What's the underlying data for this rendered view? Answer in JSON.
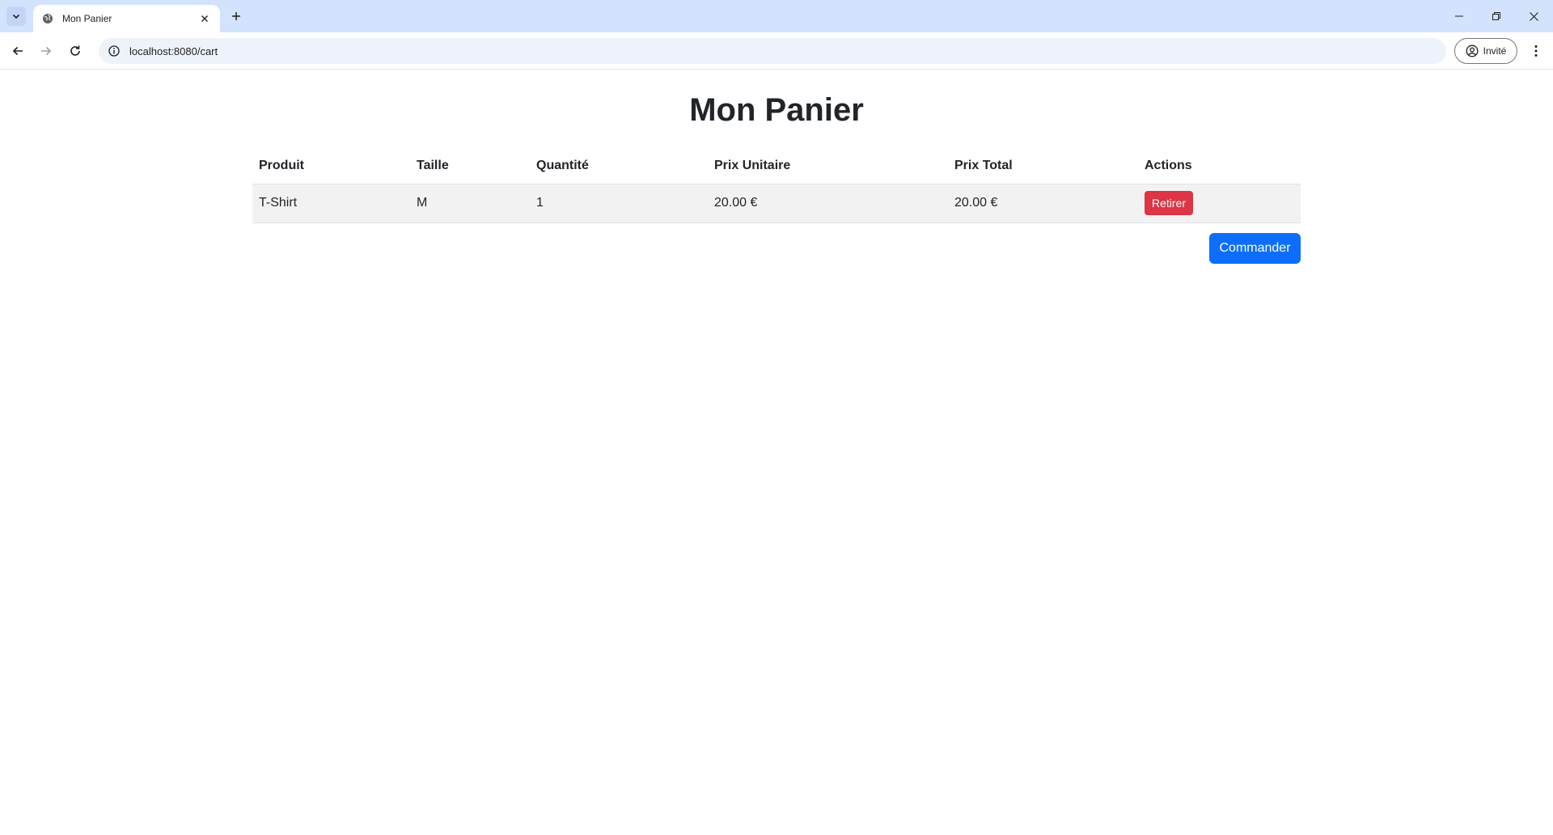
{
  "browser": {
    "tab_title": "Mon Panier",
    "url": "localhost:8080/cart",
    "profile_label": "Invité"
  },
  "page": {
    "title": "Mon Panier",
    "table": {
      "headers": [
        "Produit",
        "Taille",
        "Quantité",
        "Prix Unitaire",
        "Prix Total",
        "Actions"
      ],
      "rows": [
        {
          "product": "T-Shirt",
          "size": "M",
          "quantity": "1",
          "unit_price": "20.00 €",
          "total_price": "20.00 €",
          "action_label": "Retirer"
        }
      ]
    },
    "order_button_label": "Commander"
  },
  "colors": {
    "danger": "#dc3545",
    "primary": "#0d6efd",
    "titlebar": "#d3e3fd"
  }
}
